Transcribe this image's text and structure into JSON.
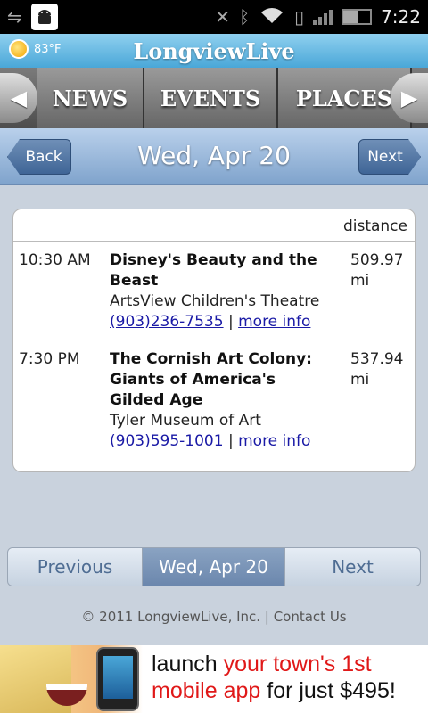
{
  "status_bar": {
    "time": "7:22",
    "icons": [
      "usb-icon",
      "android-debug-icon",
      "gps-off-icon",
      "bluetooth-icon",
      "wifi-icon",
      "vibrate-icon",
      "signal-icon",
      "battery-icon"
    ],
    "battery_level": 0.55
  },
  "app": {
    "title": "LongviewLive",
    "weather": {
      "temp": "83°F",
      "icon": "sun-icon"
    }
  },
  "nav": {
    "tabs": [
      "NEWS",
      "EVENTS",
      "PLACES"
    ]
  },
  "date_bar": {
    "back_label": "Back",
    "title": "Wed, Apr 20",
    "next_label": "Next"
  },
  "events_table": {
    "distance_header": "distance",
    "events": [
      {
        "time": "10:30 AM",
        "title": "Disney's Beauty and the Beast",
        "venue": "ArtsView Children's Theatre",
        "phone": "(903)236-7535",
        "more": "more info",
        "distance": "509.97 mi"
      },
      {
        "time": "7:30 PM",
        "title": "The Cornish Art Colony: Giants of America's Gilded Age",
        "venue": "Tyler Museum of Art",
        "phone": "(903)595-1001",
        "more": "more info",
        "distance": "537.94 mi"
      }
    ]
  },
  "pager": {
    "previous": "Previous",
    "current": "Wed, Apr 20",
    "next": "Next"
  },
  "footer": {
    "copyright": "© 2011 LongviewLive, Inc.",
    "separator": "|",
    "contact": "Contact Us"
  },
  "ad": {
    "line1_plain": "launch ",
    "line1_red": "your town's 1st",
    "line2_red": "mobile app",
    "line2_plain": " for just $495!"
  },
  "colors": {
    "accent_blue": "#4aa7d8",
    "date_bar": "#7fa3cc",
    "link": "#1a1aa6",
    "ad_red": "#e01818"
  }
}
